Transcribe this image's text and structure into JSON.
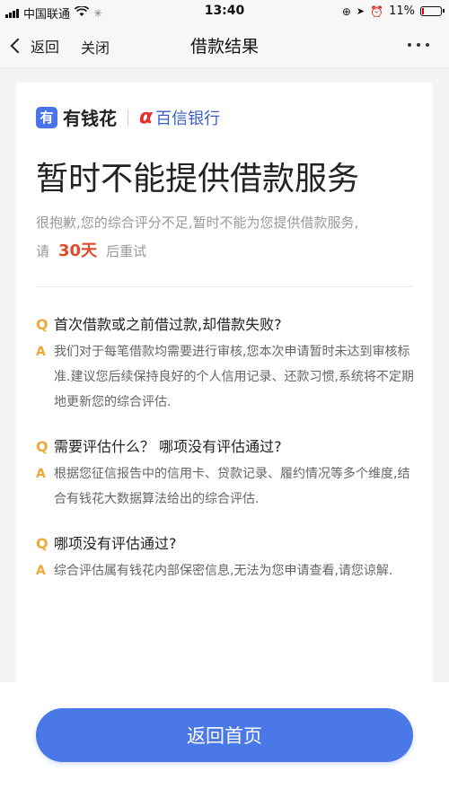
{
  "status_bar": {
    "carrier": "中国联通",
    "time": "13:40",
    "battery_percent": "11%",
    "battery_level": 0.11
  },
  "nav": {
    "back_label": "返回",
    "close_label": "关闭",
    "title": "借款结果"
  },
  "brand": {
    "logo_char": "有",
    "name": "有钱花",
    "bank_mark": "α",
    "bank_name": "百信银行"
  },
  "result": {
    "title": "暂时不能提供借款服务",
    "message": "很抱歉,您的综合评分不足,暂时不能为您提供借款服务,",
    "retry_prefix": "请",
    "retry_days": "30天",
    "retry_suffix": "后重试"
  },
  "faq": [
    {
      "q_letter": "Q",
      "question": "首次借款或之前借过款,却借款失败?",
      "a_letter": "A",
      "answer": "我们对于每笔借款均需要进行审核,您本次申请暂时未达到审核标准.建议您后续保持良好的个人信用记录、还款习惯,系统将不定期地更新您的综合评估."
    },
    {
      "q_letter": "Q",
      "question": "需要评估什么？ 哪项没有评估通过?",
      "a_letter": "A",
      "answer": "根据您征信报告中的信用卡、贷款记录、履约情况等多个维度,结合有钱花大数据算法给出的综合评估."
    },
    {
      "q_letter": "Q",
      "question": "哪项没有评估通过?",
      "a_letter": "A",
      "answer": "综合评估属有钱花内部保密信息,无法为您申请查看,请您谅解."
    }
  ],
  "footer": {
    "home_button": "返回首页"
  },
  "colors": {
    "accent": "#4a78e6",
    "warning": "#e24a2a",
    "qa_letter": "#f0a83a"
  }
}
